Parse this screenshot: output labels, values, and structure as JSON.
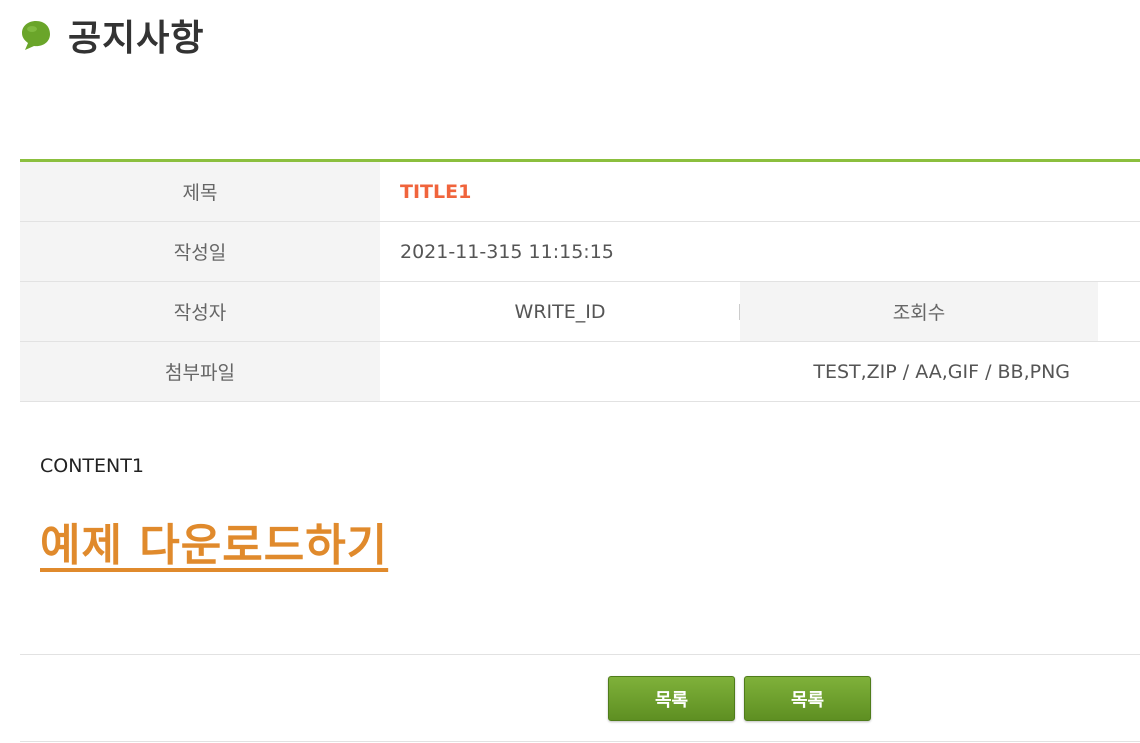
{
  "header": {
    "title": "공지사항",
    "icon": "leaf-icon",
    "icon_color": "#6aa52a"
  },
  "detail": {
    "title_label": "제목",
    "title_value": "TITLE1",
    "date_label": "작성일",
    "date_value": "2021-11-315 11:15:15",
    "writer_label": "작성자",
    "writer_value": "WRITE_ID",
    "views_label": "조회수",
    "views_value": "",
    "attachment_label": "첨부파일",
    "attachment_value": "TEST,ZIP / AA,GIF / BB,PNG"
  },
  "content": {
    "text": "CONTENT1",
    "download_link": "예제 다운로드하기"
  },
  "buttons": {
    "list1": "목록",
    "list2": "목록"
  },
  "colors": {
    "accent_green": "#8bbf3e",
    "title_orange": "#f0643c",
    "link_orange": "#e08a2c",
    "button_green": "#6a9b2c"
  }
}
